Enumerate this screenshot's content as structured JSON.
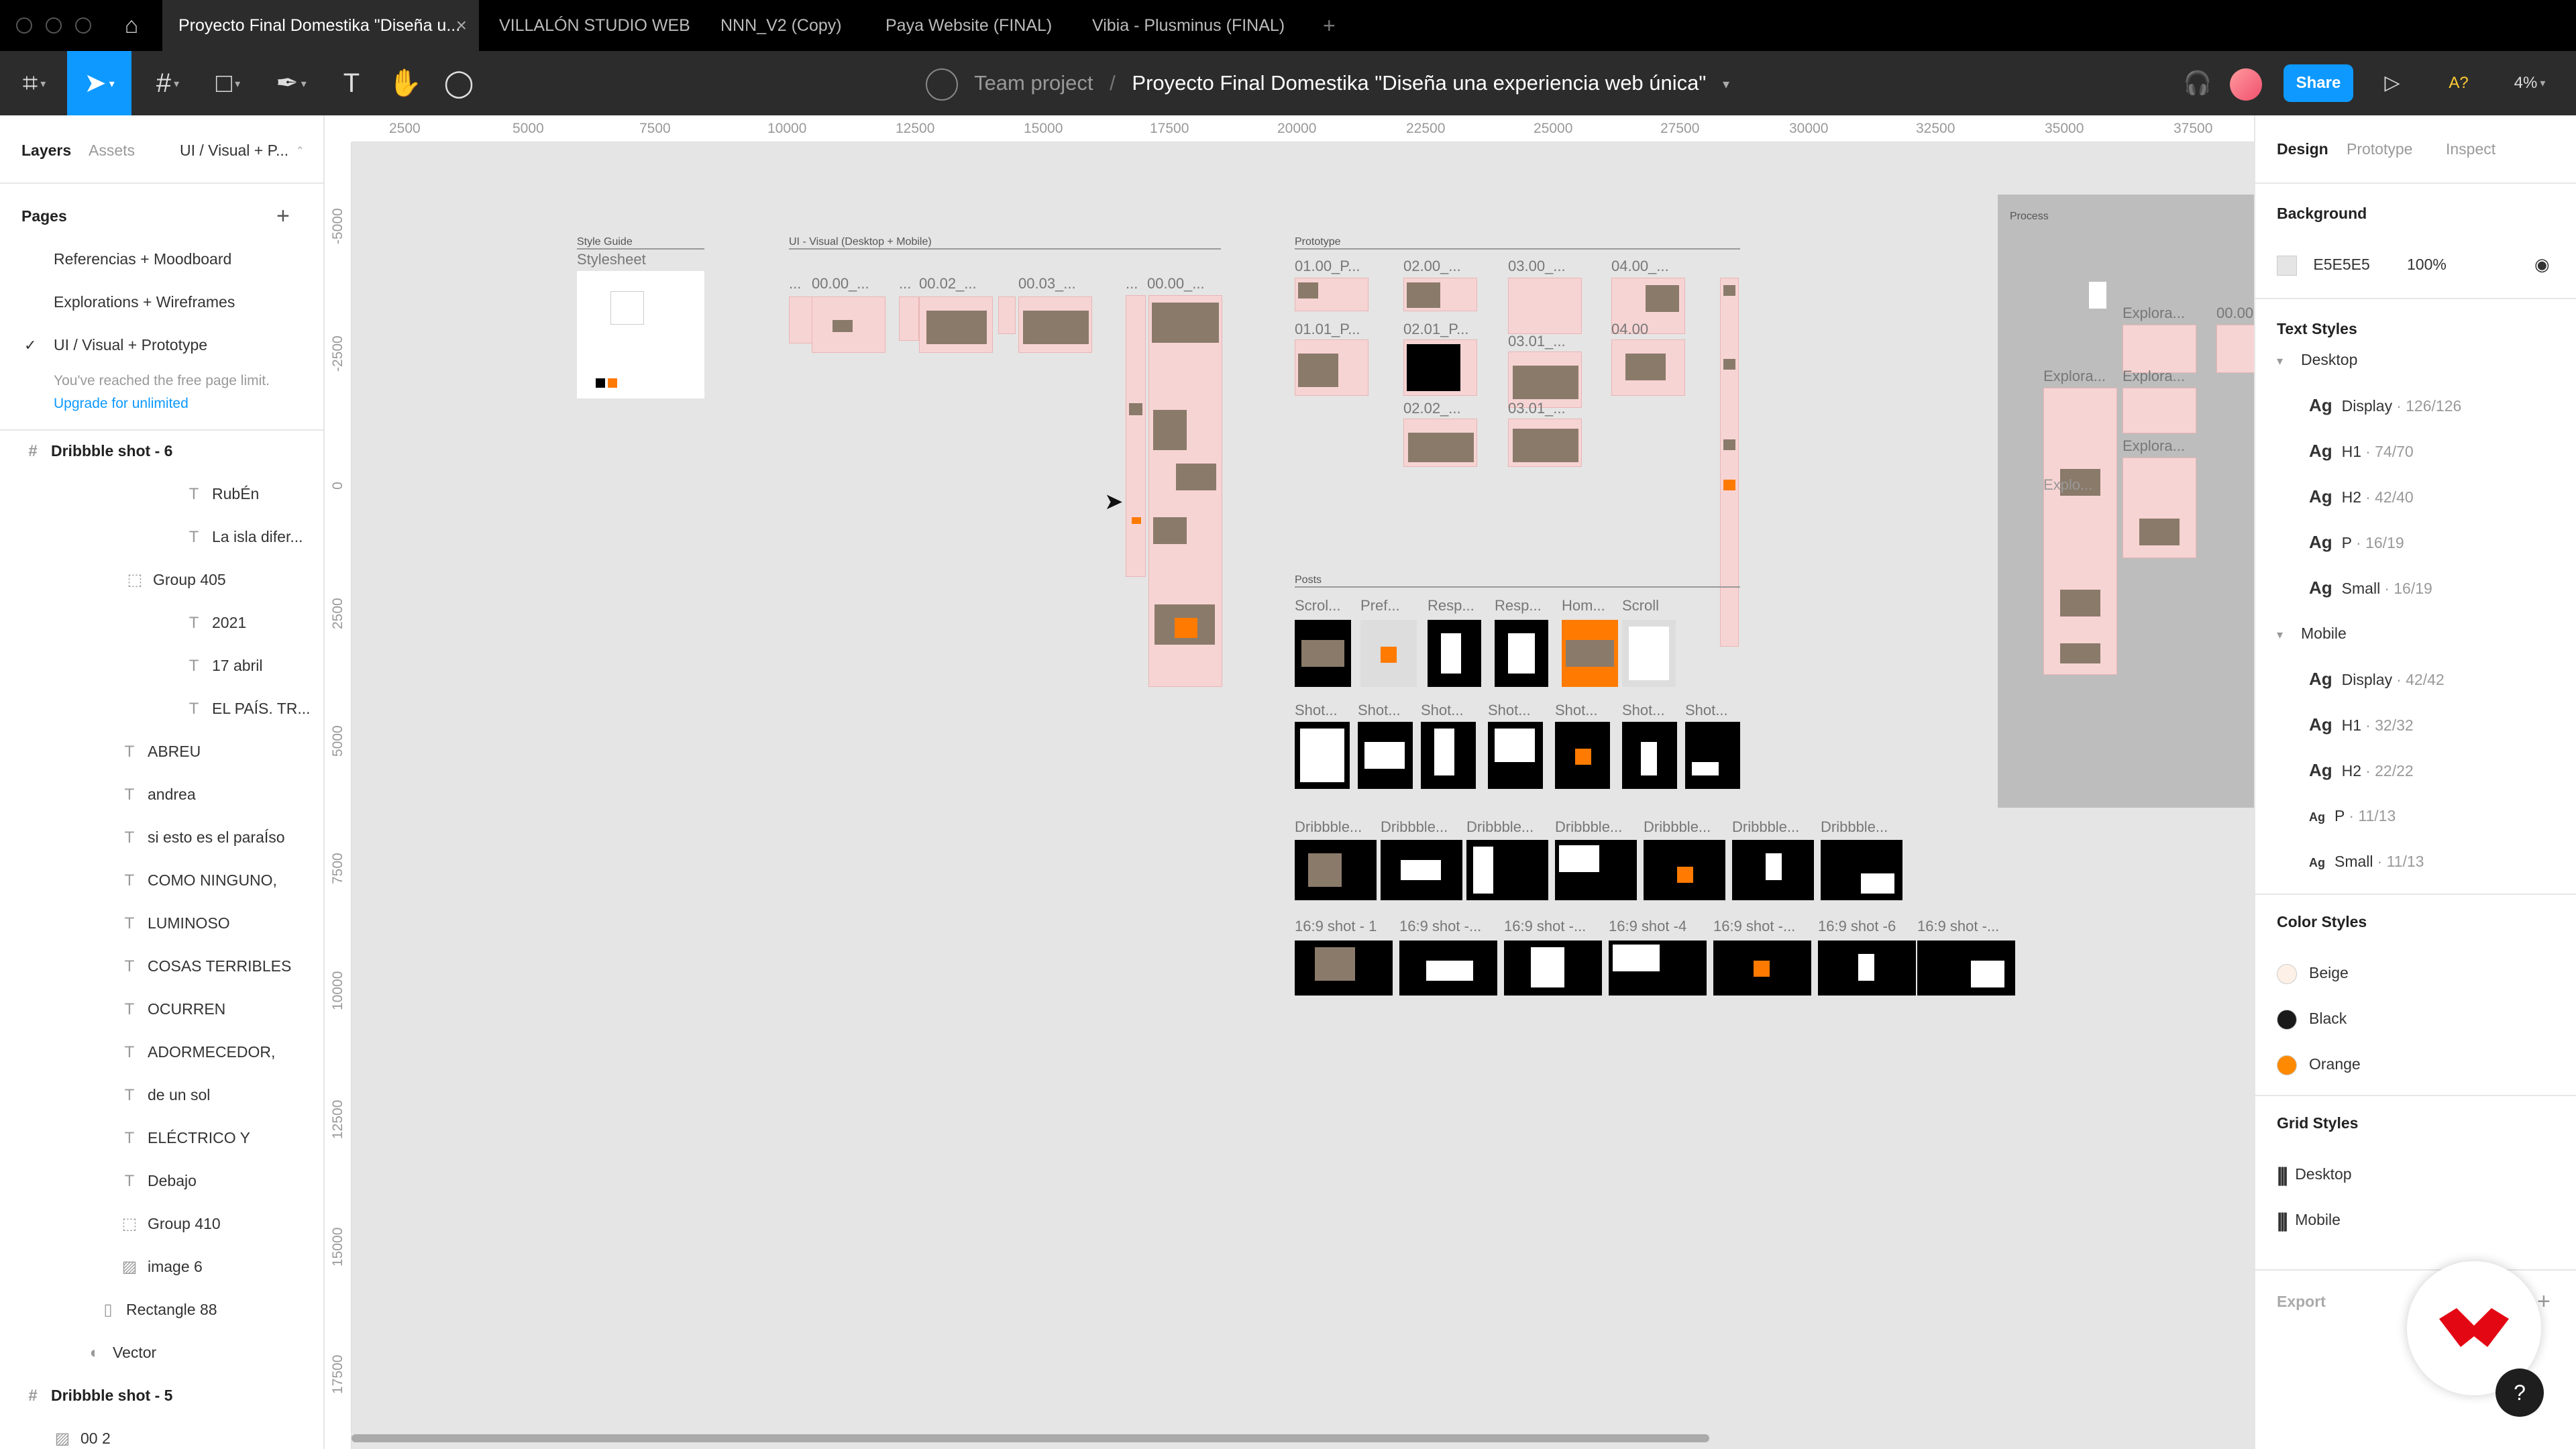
{
  "tabs": [
    {
      "label": "Proyecto Final Domestika \"Diseña u...",
      "active": true
    },
    {
      "label": "VILLALÓN STUDIO WEB"
    },
    {
      "label": "NNN_V2 (Copy)"
    },
    {
      "label": "Paya Website (FINAL)"
    },
    {
      "label": "Vibia - Plusminus (FINAL)"
    }
  ],
  "toolbar": {
    "team": "Team project",
    "separator": "/",
    "file_title": "Proyecto Final Domestika \"Diseña una experiencia web única\"",
    "share": "Share",
    "zoom": "4%",
    "accessibility": "A?"
  },
  "left_panel": {
    "tabs": {
      "layers": "Layers",
      "assets": "Assets",
      "page_selector": "UI / Visual + P..."
    },
    "pages_title": "Pages",
    "pages": [
      {
        "label": "Referencias + Moodboard"
      },
      {
        "label": "Explorations + Wireframes"
      },
      {
        "label": "UI / Visual + Prototype",
        "selected": true
      }
    ],
    "limit_note": "You've reached the free page limit.",
    "upgrade": "Upgrade for unlimited",
    "layers": [
      {
        "label": "Dribbble shot - 6",
        "icon": "#"
      },
      {
        "label": "RubÉn",
        "icon": "T"
      },
      {
        "label": "La isla difer...",
        "icon": "T"
      },
      {
        "label": "Group 405",
        "icon": "⬚"
      },
      {
        "label": "2021",
        "icon": "T"
      },
      {
        "label": "17 abril",
        "icon": "T"
      },
      {
        "label": "EL PAÍS. TR...",
        "icon": "T"
      },
      {
        "label": "ABREU",
        "icon": "T"
      },
      {
        "label": "andrea",
        "icon": "T"
      },
      {
        "label": "si esto es el paraÍso",
        "icon": "T"
      },
      {
        "label": "COMO NINGUNO,",
        "icon": "T"
      },
      {
        "label": "LUMINOSO",
        "icon": "T"
      },
      {
        "label": "COSAS TERRIBLES",
        "icon": "T"
      },
      {
        "label": "OCURREN",
        "icon": "T"
      },
      {
        "label": "ADORMECEDOR,",
        "icon": "T"
      },
      {
        "label": "de un sol",
        "icon": "T"
      },
      {
        "label": "ELÉCTRICO Y",
        "icon": "T"
      },
      {
        "label": "Debajo",
        "icon": "T"
      },
      {
        "label": "Group 410",
        "icon": "⬚"
      },
      {
        "label": "image 6",
        "icon": "▨"
      },
      {
        "label": "Rectangle 88",
        "icon": "▯"
      },
      {
        "label": "Vector",
        "icon": "◐"
      },
      {
        "label": "Dribbble shot - 5",
        "icon": "#"
      },
      {
        "label": "00 2",
        "icon": "▨"
      }
    ]
  },
  "ruler": {
    "top": [
      "2500",
      "5000",
      "7500",
      "10000",
      "12500",
      "15000",
      "17500",
      "20000",
      "22500",
      "25000",
      "27500",
      "30000",
      "32500",
      "35000",
      "37500"
    ],
    "left": [
      "-5000",
      "-2500",
      "0",
      "2500",
      "5000",
      "7500",
      "10000",
      "12500",
      "15000",
      "17500"
    ]
  },
  "canvas": {
    "style_guide_label": "Style Guide",
    "stylesheet_label": "Stylesheet",
    "ui_visual_label": "UI - Visual (Desktop + Mobile)",
    "prototype_label": "Prototype",
    "posts_label": "Posts",
    "process_label": "Process",
    "ui_frames": [
      "...",
      "00.00_...",
      "...",
      "00.02_...",
      "00.03_...",
      "...",
      "00.00_..."
    ],
    "proto_frames": [
      "01.00_P...",
      "02.00_...",
      "03.00_...",
      "04.00_...",
      "01.01_P...",
      "02.01_P...",
      "03.01_...",
      "04.00",
      "02.02_...",
      "03.01_..."
    ],
    "posts_row1": [
      "Scrol...",
      "Pref...",
      "Resp...",
      "Resp...",
      "Hom...",
      "Scroll"
    ],
    "posts_row2": [
      "Shot...",
      "Shot...",
      "Shot...",
      "Shot...",
      "Shot...",
      "Shot...",
      "Shot..."
    ],
    "posts_row3": [
      "Dribbble...",
      "Dribbble...",
      "Dribbble...",
      "Dribbble...",
      "Dribbble...",
      "Dribbble...",
      "Dribbble..."
    ],
    "posts_row4": [
      "16:9 shot - 1",
      "16:9  shot -...",
      "16:9  shot -...",
      "16:9  shot -4",
      "16:9  shot -...",
      "16:9  shot -6",
      "16:9  shot -..."
    ],
    "process_frames": [
      "Explora...",
      "00.00",
      "Explora...",
      "Explora...",
      "Explora...",
      "Explo..."
    ]
  },
  "right_panel": {
    "tabs": {
      "design": "Design",
      "prototype": "Prototype",
      "inspect": "Inspect"
    },
    "background_title": "Background",
    "background_hex": "E5E5E5",
    "background_opacity": "100%",
    "text_styles_title": "Text Styles",
    "desktop_group": "Desktop",
    "desktop_styles": [
      {
        "ag": "Ag",
        "name": "Display",
        "meta": "· 126/126"
      },
      {
        "ag": "Ag",
        "name": "H1",
        "meta": "· 74/70"
      },
      {
        "ag": "Ag",
        "name": "H2",
        "meta": "· 42/40"
      },
      {
        "ag": "Ag",
        "name": "P",
        "meta": "· 16/19"
      },
      {
        "ag": "Ag",
        "name": "Small",
        "meta": "· 16/19"
      }
    ],
    "mobile_group": "Mobile",
    "mobile_styles": [
      {
        "ag": "Ag",
        "name": "Display",
        "meta": "· 42/42"
      },
      {
        "ag": "Ag",
        "name": "H1",
        "meta": "· 32/32"
      },
      {
        "ag": "Ag",
        "name": "H2",
        "meta": "· 22/22"
      },
      {
        "ag": "Ag",
        "name": "P",
        "meta": "· 11/13"
      },
      {
        "ag": "Ag",
        "name": "Small",
        "meta": "· 11/13"
      }
    ],
    "color_styles_title": "Color Styles",
    "colors": [
      {
        "name": "Beige",
        "hex": "#fdf0e6"
      },
      {
        "name": "Black",
        "hex": "#1a1a1a"
      },
      {
        "name": "Orange",
        "hex": "#ff8a00"
      }
    ],
    "grid_styles_title": "Grid Styles",
    "grids": [
      {
        "name": "Desktop"
      },
      {
        "name": "Mobile"
      }
    ],
    "export_title": "Export",
    "help": "?"
  },
  "colors": {
    "accent": "#0d99ff",
    "canvas": "#e5e5e5",
    "toolbar": "#2c2c2c",
    "brand_red": "#e30613"
  }
}
